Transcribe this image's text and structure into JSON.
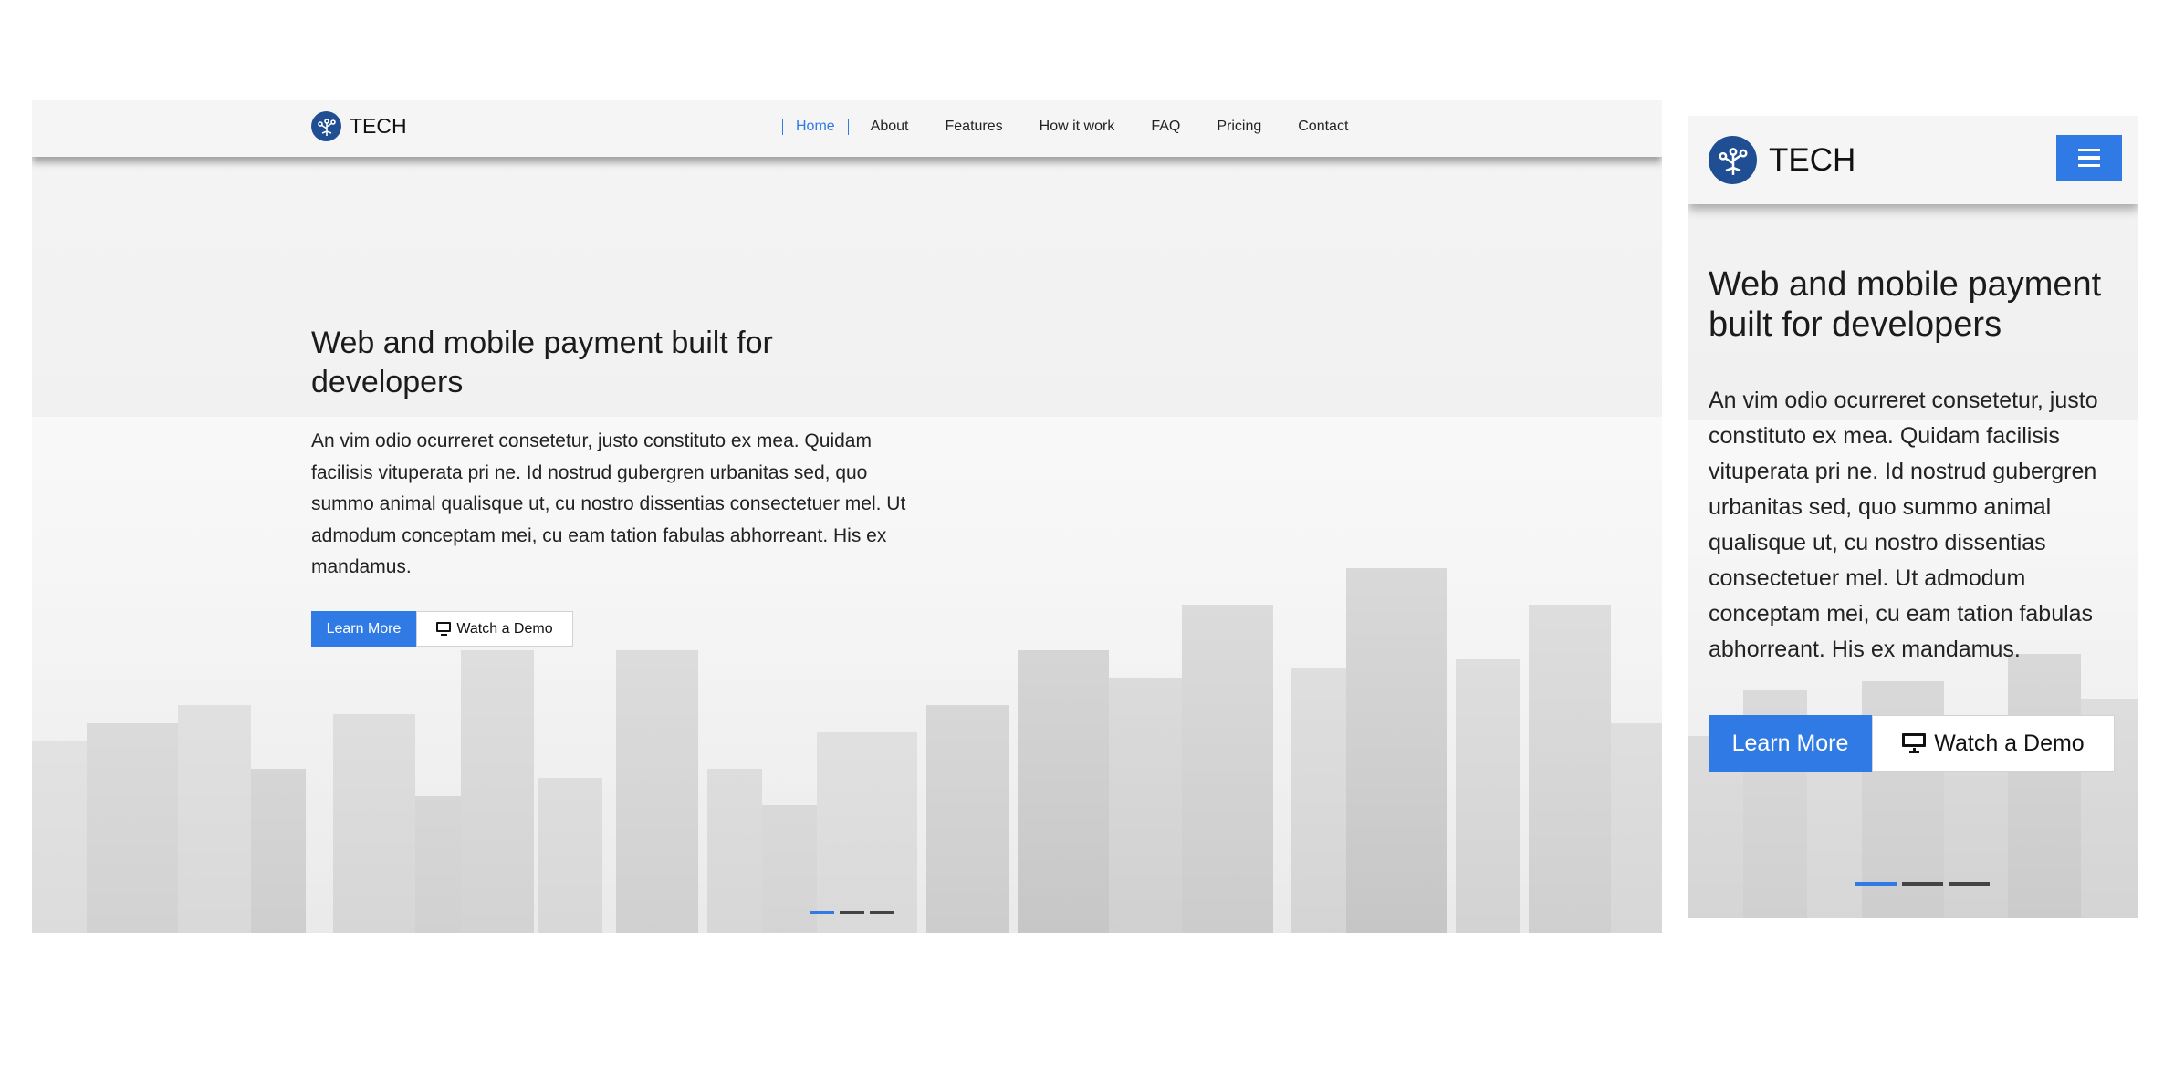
{
  "brand": {
    "name": "TECH",
    "logo_icon": "circuit-tree-icon"
  },
  "nav": {
    "items": [
      {
        "label": "Home",
        "active": true
      },
      {
        "label": "About",
        "active": false
      },
      {
        "label": "Features",
        "active": false
      },
      {
        "label": "How it work",
        "active": false
      },
      {
        "label": "FAQ",
        "active": false
      },
      {
        "label": "Pricing",
        "active": false
      },
      {
        "label": "Contact",
        "active": false
      }
    ],
    "toggle_icon": "hamburger-menu-icon"
  },
  "hero": {
    "title": "Web and mobile payment built for developers",
    "text": "An vim odio ocurreret consetetur, justo constituto ex mea. Quidam facilisis vituperata pri ne. Id nostrud gubergren urbanitas sed, quo summo animal qualisque ut, cu nostro dissentias consectetuer mel. Ut admodum conceptam mei, cu eam tation fabulas abhorreant. His ex mandamus.",
    "primary_button": "Learn More",
    "secondary_button": "Watch a Demo",
    "secondary_icon": "monitor-icon"
  },
  "carousel": {
    "slides": 3,
    "active_index": 0
  },
  "colors": {
    "accent": "#2f7ae5",
    "logo": "#1f4e93",
    "navbar_bg": "#f5f5f5"
  }
}
